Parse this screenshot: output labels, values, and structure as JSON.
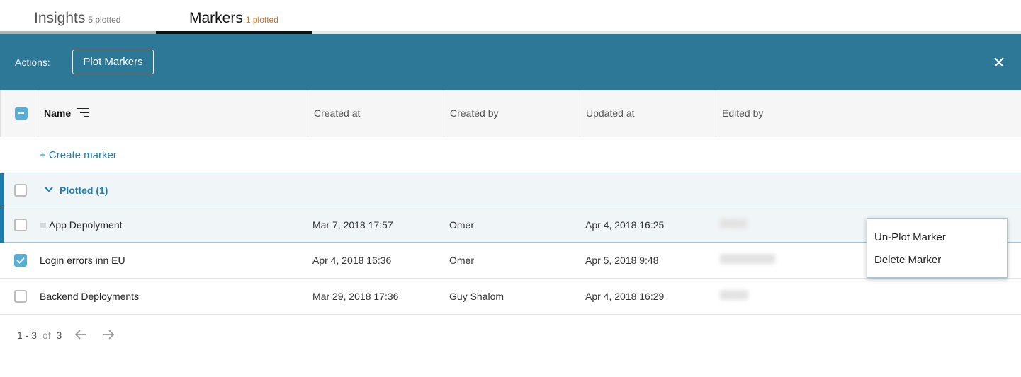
{
  "tabs": [
    {
      "label": "Insights",
      "count": "5 plotted",
      "active": false
    },
    {
      "label": "Markers",
      "count": "1 plotted",
      "active": true
    }
  ],
  "actions": {
    "label": "Actions:",
    "plot_button": "Plot Markers",
    "close_icon": "close-icon"
  },
  "table": {
    "columns": [
      "Name",
      "Created at",
      "Created by",
      "Updated at",
      "Edited by"
    ],
    "select_all_state": "indeterminate",
    "create_link": "+ Create marker",
    "group": {
      "title": "Plotted (1)",
      "expanded": true,
      "rows": [
        {
          "name": "App Depolyment",
          "created_at": "Mar 7, 2018 17:57",
          "created_by": "Omer",
          "updated_at": "Apr 4, 2018 16:25",
          "edited_by": "(blurred)",
          "checked": false
        }
      ]
    },
    "rows": [
      {
        "name": "Login errors inn EU",
        "created_at": "Apr 4, 2018 16:36",
        "created_by": "Omer",
        "updated_at": "Apr 5, 2018 9:48",
        "edited_by": "(blurred)",
        "checked": true
      },
      {
        "name": "Backend Deployments",
        "created_at": "Mar 29, 2018 17:36",
        "created_by": "Guy Shalom",
        "updated_at": "Apr 4, 2018 16:29",
        "edited_by": "(blurred)",
        "checked": false
      }
    ]
  },
  "pagination": {
    "range": "1 - 3",
    "of": "of",
    "total": "3"
  },
  "context_menu": {
    "items": [
      "Un-Plot Marker",
      "Delete Marker"
    ]
  },
  "colors": {
    "action_bar": "#2d7797",
    "accent": "#1d7bab",
    "link": "#1f7fb0",
    "plotted_count": "#c8702a",
    "checkbox_on": "#5aaed6"
  }
}
